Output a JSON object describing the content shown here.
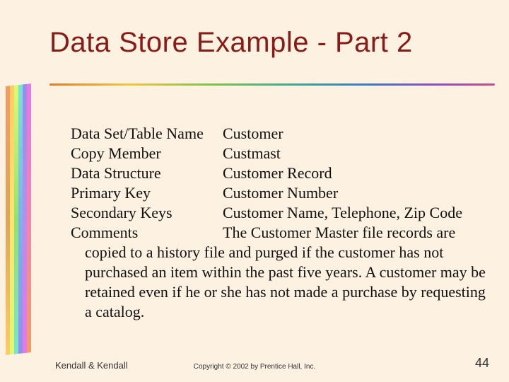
{
  "title": "Data Store Example - Part 2",
  "rows": [
    {
      "label": "Data Set/Table Name",
      "value": "Customer"
    },
    {
      "label": "Copy Member",
      "value": "Custmast"
    },
    {
      "label": "Data Structure",
      "value": "Customer Record"
    },
    {
      "label": "Primary Key",
      "value": "Customer Number"
    },
    {
      "label": "Secondary Keys",
      "value": "Customer Name, Telephone, Zip Code"
    },
    {
      "label": "Comments",
      "value": "The Customer Master file records are"
    }
  ],
  "comments_continuation": "copied to a history file and purged if the customer has not purchased an item within the past five years.  A customer may be retained even if he or she has not made a purchase by requesting a catalog.",
  "footer": {
    "left": "Kendall & Kendall",
    "center": "Copyright © 2002 by Prentice Hall, Inc.",
    "right": "44"
  }
}
